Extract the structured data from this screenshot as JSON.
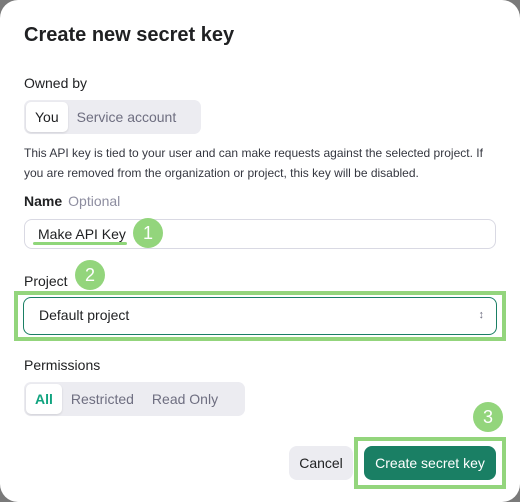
{
  "dialog": {
    "title": "Create new secret key",
    "owned_by": {
      "label": "Owned by",
      "options": [
        "You",
        "Service account"
      ],
      "selected": "You"
    },
    "description": "This API key is tied to your user and can make requests against the selected project. If you are removed from the organization or project, this key will be disabled.",
    "name": {
      "label": "Name",
      "optional_label": "Optional",
      "value": "Make API Key"
    },
    "project": {
      "label": "Project",
      "value": "Default project"
    },
    "permissions": {
      "label": "Permissions",
      "options": [
        "All",
        "Restricted",
        "Read Only"
      ],
      "selected": "All"
    },
    "buttons": {
      "cancel": "Cancel",
      "create": "Create secret key"
    }
  },
  "annotations": {
    "badges": [
      "1",
      "2",
      "3"
    ],
    "highlight_color": "#93d57c"
  },
  "colors": {
    "accent": "#1a7f64",
    "selected_teal": "#10a37f"
  },
  "icons": {
    "select_chevron": "chevron-up-down-icon"
  }
}
